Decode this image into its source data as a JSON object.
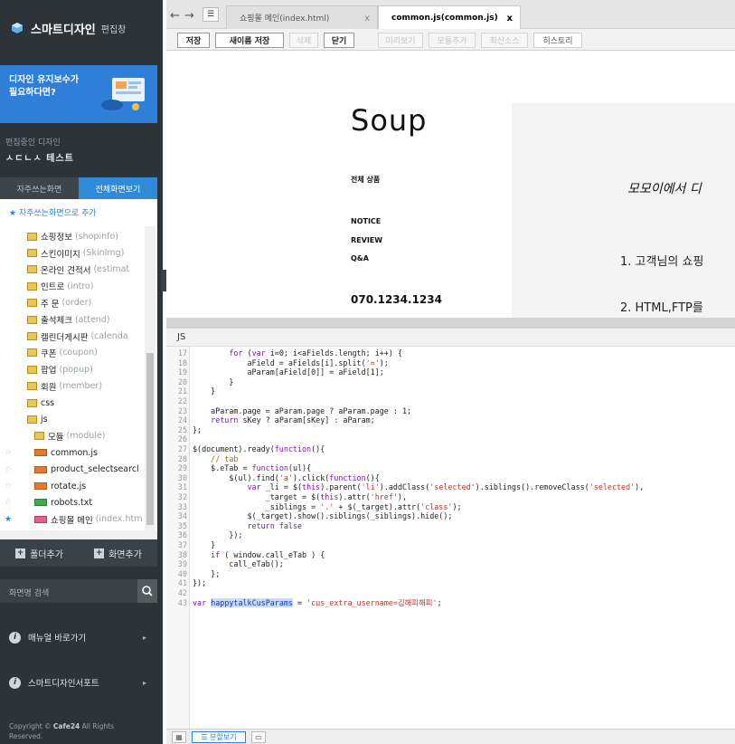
{
  "app": {
    "title": "스마트디자인",
    "subtitle": "편집창"
  },
  "banner": {
    "line1": "디자인 유지보수가",
    "line2": "필요하다면?"
  },
  "editing": {
    "label": "편집중인 디자인",
    "name": "ㅅㄷㄴㅅ 테스트"
  },
  "sidebar_tabs": {
    "fav": "자주쓰는화면",
    "all": "전체화면보기"
  },
  "tree": {
    "add_fav": "★ 자주쓰는화면으로 추가",
    "items": [
      {
        "name": "쇼핑정보",
        "en": "(shopinfo)",
        "type": "folder",
        "star": ""
      },
      {
        "name": "스킨이미지",
        "en": "(SkinImg)",
        "type": "folder",
        "star": ""
      },
      {
        "name": "온라인 견적서",
        "en": "(estimat",
        "type": "folder",
        "star": ""
      },
      {
        "name": "인트로",
        "en": "(intro)",
        "type": "folder",
        "star": ""
      },
      {
        "name": "주 문",
        "en": "(order)",
        "type": "folder",
        "star": ""
      },
      {
        "name": "출석체크",
        "en": "(attend)",
        "type": "folder",
        "star": ""
      },
      {
        "name": "캘린더게시판",
        "en": "(calenda",
        "type": "folder",
        "star": ""
      },
      {
        "name": "쿠폰",
        "en": "(coupon)",
        "type": "folder",
        "star": ""
      },
      {
        "name": "팝업",
        "en": "(popup)",
        "type": "folder",
        "star": ""
      },
      {
        "name": "회원",
        "en": "(member)",
        "type": "folder",
        "star": ""
      },
      {
        "name": "css",
        "en": "",
        "type": "folder",
        "star": ""
      },
      {
        "name": "js",
        "en": "",
        "type": "folder-open",
        "star": ""
      },
      {
        "name": "모듈",
        "en": "(module)",
        "type": "folder",
        "star": ""
      },
      {
        "name": "common.js",
        "en": "",
        "type": "file",
        "star": "☆"
      },
      {
        "name": "product_selectsearcl",
        "en": "",
        "type": "file",
        "star": "☆"
      },
      {
        "name": "rotate.js",
        "en": "",
        "type": "file",
        "star": "☆"
      },
      {
        "name": "robots.txt",
        "en": "",
        "type": "file-green",
        "star": "☆"
      },
      {
        "name": "쇼핑몰 메인",
        "en": "(index.htm",
        "type": "file-pink",
        "star": "★"
      }
    ]
  },
  "buttons": {
    "add_folder": "폴더추가",
    "add_screen": "화면추가"
  },
  "search": {
    "placeholder": "화면명 검색"
  },
  "menu": {
    "manual": "매뉴얼 바로가기",
    "support": "스마트디자인서포트"
  },
  "copyright": {
    "text1": "Copyright ©",
    "brand": "Cafe24",
    "text2": "All Rights Reserved."
  },
  "filetabs": [
    {
      "label": "쇼핑몰 메인(index.html)",
      "close": "x"
    },
    {
      "label": "common.js(common.js)",
      "close": "x"
    }
  ],
  "toolbar": {
    "save": "저장",
    "save_as": "새이름 저장",
    "delete": "삭제",
    "close": "닫기",
    "preview": "미리보기",
    "module_add": "모듈추가",
    "minify": "최신소스",
    "history": "히스토리"
  },
  "preview": {
    "logo": "Soup",
    "category": "전체 상품",
    "menu": [
      "NOTICE",
      "REVIEW",
      "Q&A"
    ],
    "phone": "070.1234.1234",
    "headline": "모모이에서 디",
    "line1": "1. 고객님의 쇼핑",
    "line2": "2. HTML,FTP를"
  },
  "editor": {
    "label": "JS",
    "lines": [
      {
        "n": "17",
        "html": "        <span class='kw'>for</span> (<span class='kw'>var</span> i=0; i&lt;aFields.length; i++) {"
      },
      {
        "n": "18",
        "html": "            aField = aFields[i].split(<span class='st'>'='</span>);"
      },
      {
        "n": "19",
        "html": "            aParam[aField[0]] = aField[1];"
      },
      {
        "n": "20",
        "html": "        }"
      },
      {
        "n": "21",
        "html": "    }"
      },
      {
        "n": "22",
        "html": ""
      },
      {
        "n": "23",
        "html": "    aParam.page = aParam.page ? aParam.page : 1;"
      },
      {
        "n": "24",
        "html": "    <span class='kw'>return</span> sKey ? aParam[sKey] : aParam;"
      },
      {
        "n": "25",
        "html": "};"
      },
      {
        "n": "26",
        "html": ""
      },
      {
        "n": "27",
        "html": "$(document).ready(<span class='kw'>function</span>(){"
      },
      {
        "n": "28",
        "html": "    <span class='cm'>// tab</span>"
      },
      {
        "n": "29",
        "html": "    $.eTab = <span class='kw'>function</span>(ul){"
      },
      {
        "n": "30",
        "html": "        $(ul).find(<span class='st'>'a'</span>).click(<span class='kw'>function</span>(){"
      },
      {
        "n": "31",
        "html": "            <span class='kw'>var</span> _li = $(<span class='kw'>this</span>).parent(<span class='st'>'li'</span>).addClass(<span class='st'>'selected'</span>).siblings().removeClass(<span class='st'>'selected'</span>),"
      },
      {
        "n": "32",
        "html": "                _target = $(<span class='kw'>this</span>).attr(<span class='st'>'href'</span>),"
      },
      {
        "n": "33",
        "html": "                _siblings = <span class='st'>'.'</span> + $(_target).attr(<span class='st'>'class'</span>);"
      },
      {
        "n": "34",
        "html": "            $(_target).show().siblings(_siblings).hide();"
      },
      {
        "n": "35",
        "html": "            <span class='kw'>return</span> <span class='kw'>false</span>"
      },
      {
        "n": "36",
        "html": "        });"
      },
      {
        "n": "37",
        "html": "    }"
      },
      {
        "n": "38",
        "html": "    <span class='kw'>if</span> ( window.call_eTab ) {"
      },
      {
        "n": "39",
        "html": "        call_eTab();"
      },
      {
        "n": "40",
        "html": "    };"
      },
      {
        "n": "41",
        "html": "});"
      },
      {
        "n": "42",
        "html": ""
      },
      {
        "n": "43",
        "html": "<span class='kw'>var</span> <span class='vr hl'>happytalkCusParams</span> = <span class='st'>'cus_extra_username=김해피해피'</span>;"
      }
    ]
  },
  "status": {
    "split": "분할보기"
  }
}
